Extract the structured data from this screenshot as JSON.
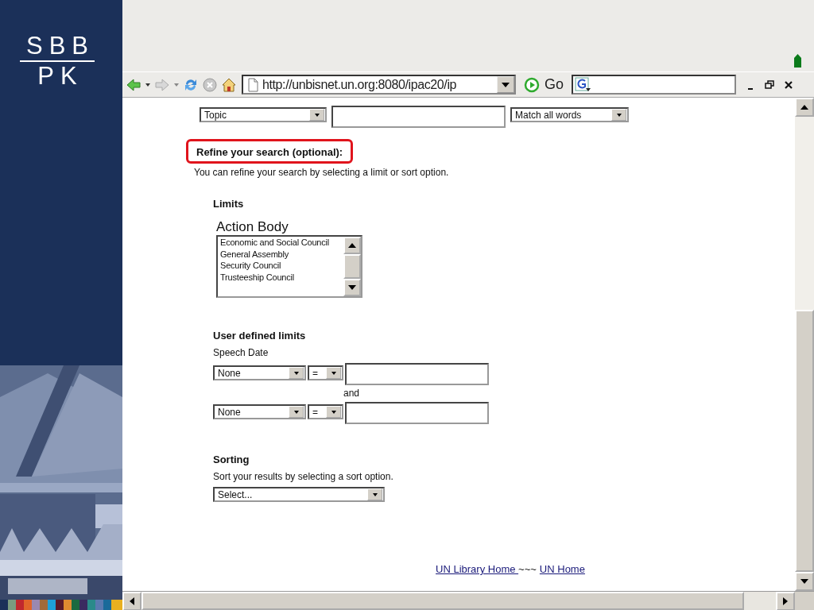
{
  "logo": {
    "line_1": "SBB",
    "line_2": "PK"
  },
  "toolbar": {
    "address": "http://unbisnet.un.org:8080/ipac20/ip",
    "go": "Go"
  },
  "search_row": {
    "field_select": "Topic",
    "match_select": "Match all words"
  },
  "refine": {
    "heading": "Refine your search (optional):",
    "highlighted": true,
    "intro": "You can refine your search by selecting a limit or sort option."
  },
  "limits": {
    "heading": "Limits",
    "label": "Action Body",
    "options": [
      {
        "label": "Economic and Social Council",
        "selected": false
      },
      {
        "label": "General Assembly",
        "selected": false
      },
      {
        "label": "Security Council",
        "selected": false
      },
      {
        "label": "Trusteeship Council",
        "selected": false
      }
    ]
  },
  "user_limits": {
    "heading": "User defined limits",
    "label": "Speech Date",
    "joiner": "and",
    "rows": [
      {
        "field": "None",
        "operator": "="
      },
      {
        "field": "None",
        "operator": "="
      }
    ]
  },
  "sorting": {
    "heading": "Sorting",
    "hint": "Sort your results by selecting a sort option.",
    "select": "Select..."
  },
  "footer": {
    "separator": "~~~",
    "links": [
      {
        "label": "UN Library Home "
      },
      {
        "label": "UN Home"
      }
    ]
  }
}
